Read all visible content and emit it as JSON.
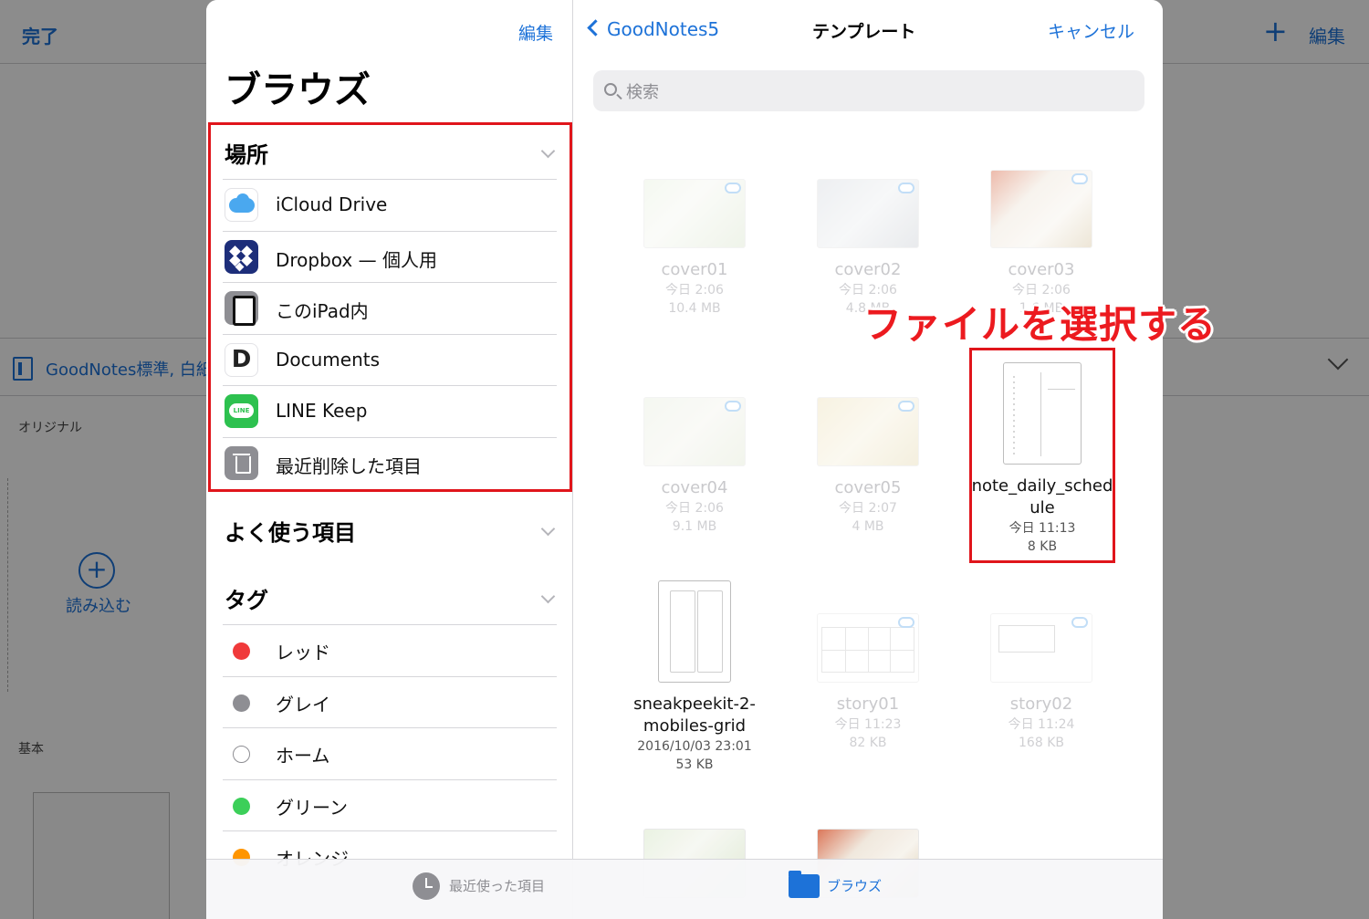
{
  "background": {
    "done_label": "完了",
    "plus_label": "+",
    "edit_label": "編集",
    "template_bar_text": "GoodNotes標準, 白紙",
    "section_original": "オリジナル",
    "import_label": "読み込む",
    "import_plus": "+",
    "section_basic": "基本"
  },
  "sidebar": {
    "edit_label": "編集",
    "title": "ブラウズ",
    "locations_header": "場所",
    "locations": [
      {
        "label": "iCloud Drive",
        "icon": "icloud-icon"
      },
      {
        "label": "Dropbox — 個人用",
        "icon": "dropbox-icon"
      },
      {
        "label": "このiPad内",
        "icon": "ipad-icon"
      },
      {
        "label": "Documents",
        "icon": "documents-icon",
        "glyph": "D"
      },
      {
        "label": "LINE Keep",
        "icon": "line-icon"
      },
      {
        "label": "最近削除した項目",
        "icon": "trash-icon"
      }
    ],
    "favorites_header": "よく使う項目",
    "tags_header": "タグ",
    "tags": [
      {
        "label": "レッド",
        "color": "#f0393a"
      },
      {
        "label": "グレイ",
        "color": "#8e8e93"
      },
      {
        "label": "ホーム",
        "color": "#ffffff"
      },
      {
        "label": "グリーン",
        "color": "#3ccf59"
      },
      {
        "label": "オレンジ",
        "color": "#ff9500"
      }
    ]
  },
  "pane": {
    "back_label": "GoodNotes5",
    "title": "テンプレート",
    "cancel_label": "キャンセル",
    "search_placeholder": "検索",
    "files": [
      {
        "name": "cover01",
        "date": "今日 2:06",
        "size": "10.4 MB"
      },
      {
        "name": "cover02",
        "date": "今日 2:06",
        "size": "4.8 MB"
      },
      {
        "name": "cover03",
        "date": "今日 2:06",
        "size": "1.6 MB"
      },
      {
        "name": "cover04",
        "date": "今日 2:06",
        "size": "9.1 MB"
      },
      {
        "name": "cover05",
        "date": "今日 2:07",
        "size": "4 MB"
      },
      {
        "name": "note_daily_schedule",
        "date": "今日 11:13",
        "size": "8 KB"
      },
      {
        "name": "sneakpeekit-2-mobiles-grid",
        "date": "2016/10/03 23:01",
        "size": "53 KB"
      },
      {
        "name": "story01",
        "date": "今日 11:23",
        "size": "82 KB"
      },
      {
        "name": "story02",
        "date": "今日 11:24",
        "size": "168 KB"
      }
    ]
  },
  "annotation": "ファイルを選択する",
  "tabbar": {
    "recent_label": "最近使った項目",
    "browse_label": "ブラウズ"
  },
  "colors": {
    "accent": "#1d72d8",
    "highlight_red": "#e0151b"
  }
}
